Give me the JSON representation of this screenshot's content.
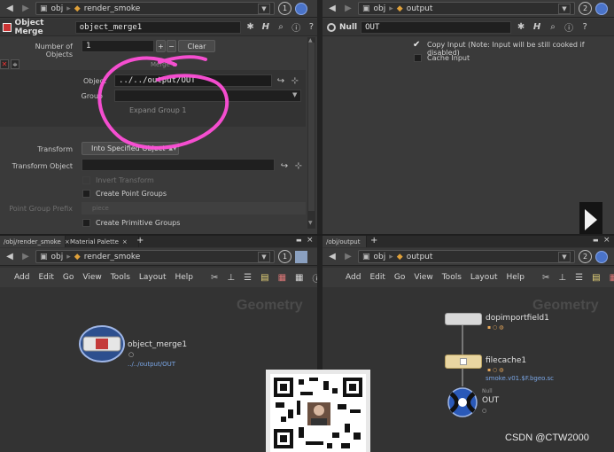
{
  "top_left": {
    "path": {
      "root": "obj",
      "node": "render_smoke"
    },
    "badge": "1",
    "node_type": "Object Merge",
    "node_name": "object_merge1",
    "params": {
      "num_objects_label": "Number of Objects",
      "num_objects_value": "1",
      "clear_label": "Clear",
      "object_label": "Object",
      "object_value": "../../output/OUT",
      "group_label": "Group",
      "expand_group_label": "Expand Group 1",
      "transform_label": "Transform",
      "transform_value": "Into Specified Object",
      "transform_object_label": "Transform Object",
      "invert_transform_label": "Invert Transform",
      "create_point_groups_label": "Create Point Groups",
      "point_group_prefix_label": "Point Group Prefix",
      "point_group_prefix_value": "piece",
      "create_primitive_groups_label": "Create Primitive Groups",
      "faded_text": "Merge 1"
    }
  },
  "top_right": {
    "path": {
      "root": "obj",
      "node": "output"
    },
    "badge": "2",
    "node_type": "Null",
    "node_name": "OUT",
    "copy_input_label": "Copy Input (Note: Input will be still cooked if disabled)",
    "cache_input_label": "Cache Input"
  },
  "bottom_left": {
    "tabs": [
      "/obj/render_smoke",
      "Material Palette"
    ],
    "path": {
      "root": "obj",
      "node": "render_smoke"
    },
    "badge": "1",
    "menu": [
      "Add",
      "Edit",
      "Go",
      "View",
      "Tools",
      "Layout",
      "Help"
    ],
    "context_label": "Geometry",
    "node": {
      "name": "object_merge1",
      "sub": "../../output/OUT"
    }
  },
  "bottom_right": {
    "tab": "/obj/output",
    "path": {
      "root": "obj",
      "node": "output"
    },
    "badge": "2",
    "menu": [
      "Add",
      "Edit",
      "Go",
      "View",
      "Tools",
      "Layout",
      "Help"
    ],
    "context_label": "Geometry",
    "nodes": [
      {
        "name": "dopimportfield1",
        "sub": ""
      },
      {
        "name": "filecache1",
        "sub": "smoke.v01.$F.bgeo.sc"
      },
      {
        "name": "OUT",
        "type": "Null"
      }
    ]
  },
  "watermark": "CSDN @CTW2000",
  "colors": {
    "annotation": "#ff4fd8",
    "link": "#7aa6e6",
    "help_blue": "#4a73c8"
  }
}
